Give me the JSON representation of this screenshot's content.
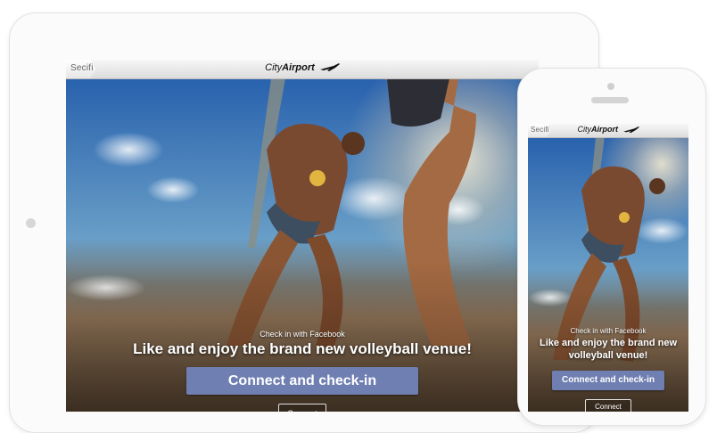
{
  "brand": {
    "secifi": "Secifi",
    "airport_city": "City",
    "airport_air": "Airport"
  },
  "checkin": {
    "label": "Check in with Facebook",
    "headline": "Like and enjoy the brand new volleyball venue!",
    "primary_button": "Connect and check-in",
    "secondary_button": "Connect"
  },
  "colors": {
    "primary_button": "#6f7fb1",
    "topbar": "#e8e8e8"
  },
  "icons": [
    "plane-icon",
    "wifi-icon"
  ]
}
